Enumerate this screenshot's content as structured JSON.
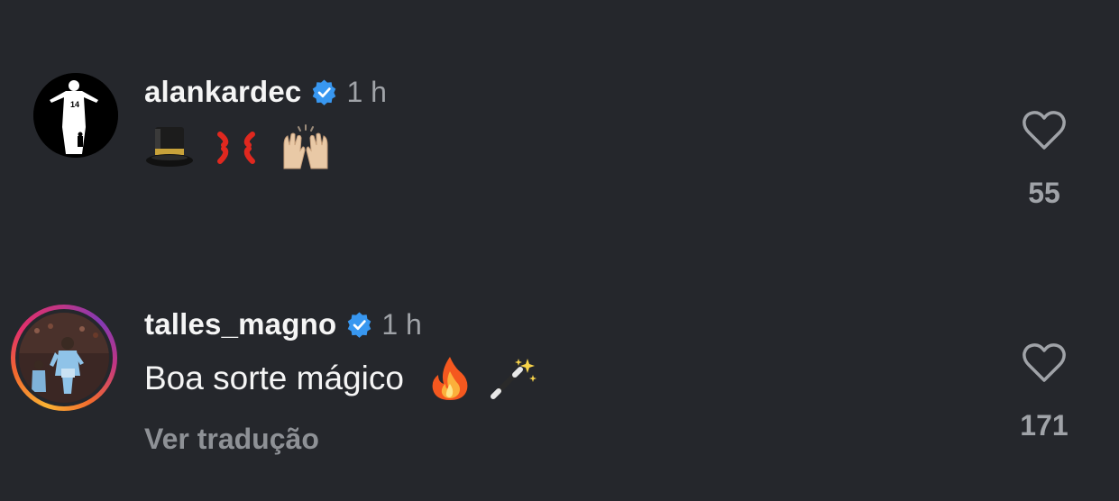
{
  "comments": [
    {
      "username": "alankardec",
      "verified": true,
      "time": "1 h",
      "text": "",
      "emojis": [
        "top-hat",
        "anger-symbol",
        "raising-hands"
      ],
      "likes": "55",
      "avatar": "player-silhouette-14"
    },
    {
      "username": "talles_magno",
      "verified": true,
      "time": "1 h",
      "text": "Boa sorte mágico",
      "emojis": [
        "fire",
        "magic-wand"
      ],
      "likes": "171",
      "translate_label": "Ver tradução",
      "avatar": "player-photo",
      "story_ring": true
    }
  ],
  "colors": {
    "background": "#25272c",
    "verified": "#3897f0",
    "secondary_text": "#a0a3a8"
  }
}
